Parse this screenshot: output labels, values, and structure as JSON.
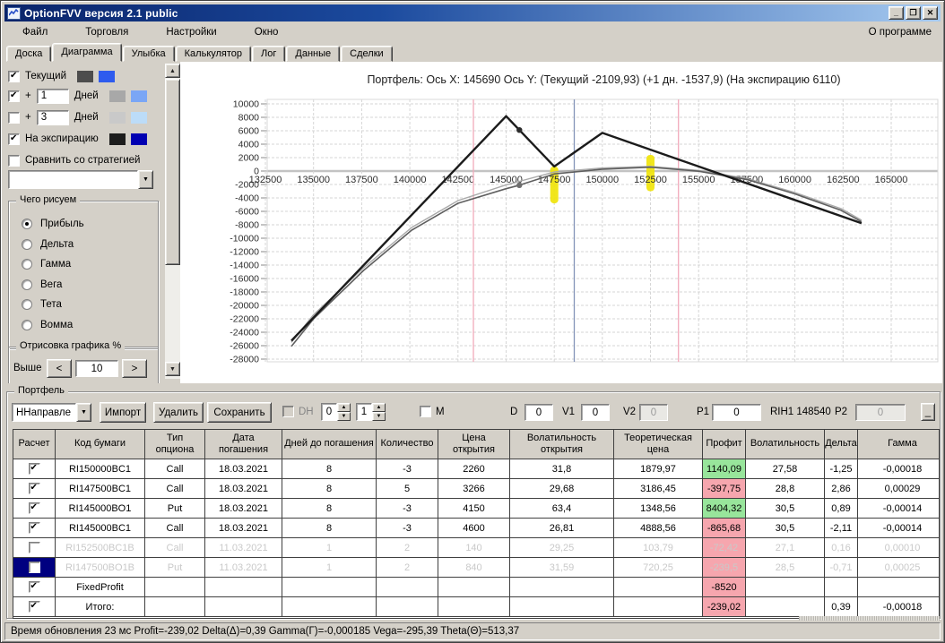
{
  "window": {
    "title": "OptionFVV версия 2.1 public",
    "buttons": {
      "minimize": "_",
      "maximize": "❐",
      "close": "✕"
    }
  },
  "menu": {
    "items": [
      "Файл",
      "Торговля",
      "Настройки",
      "Окно"
    ],
    "right_item": "О программе"
  },
  "tabs": {
    "items": [
      "Доска",
      "Диаграмма",
      "Улыбка",
      "Калькулятор",
      "Лог",
      "Данные",
      "Сделки"
    ],
    "active": "Диаграмма"
  },
  "left_panel": {
    "layers": [
      {
        "label": "Текущий",
        "checked": true,
        "swatches": [
          "#4d4d4d",
          "#2e5bee"
        ]
      },
      {
        "prefix": "+",
        "days_value": "1",
        "label": "Дней",
        "checked": true,
        "swatches": [
          "#a8a8a8",
          "#7aa6f5"
        ]
      },
      {
        "prefix": "+",
        "days_value": "3",
        "label": "Дней",
        "checked": false,
        "swatches": [
          "#c9c9c9",
          "#bcdcf8"
        ]
      },
      {
        "label": "На экспирацию",
        "checked": true,
        "swatches": [
          "#1d1d1d",
          "#0000b2"
        ]
      },
      {
        "label": "Сравнить со стратегией",
        "checked": false,
        "swatches": []
      }
    ],
    "strategy_dropdown_value": "",
    "draw_group": {
      "title": "Чего рисуем",
      "options": [
        "Прибыль",
        "Дельта",
        "Гамма",
        "Вега",
        "Тета",
        "Вомма"
      ],
      "selected": "Прибыль"
    },
    "render_group": {
      "title": "Отрисовка графика %",
      "label": "Выше",
      "dec_label": "<",
      "value": "10",
      "inc_label": ">"
    }
  },
  "chart_data": {
    "type": "line",
    "title": "Портфель: Ось X: 145690 Ось Y:  (Текущий -2109,93)  (+1 дн. -1537,9)  (На экспирацию 6110)",
    "x_range": [
      132500,
      165000
    ],
    "y_range": [
      -28000,
      10000
    ],
    "grid": true,
    "x_ticks": [
      132500,
      135000,
      137500,
      140000,
      142500,
      145000,
      147500,
      150000,
      152500,
      155000,
      157500,
      160000,
      162500,
      165000
    ],
    "y_ticks": [
      10000,
      8000,
      6000,
      4000,
      2000,
      0,
      -2000,
      -4000,
      -6000,
      -8000,
      -10000,
      -12000,
      -14000,
      -16000,
      -18000,
      -20000,
      -22000,
      -24000,
      -26000,
      -28000
    ],
    "series": [
      {
        "name": "+1 день",
        "color": "#a9a9a9",
        "width": 1.4,
        "points": [
          [
            133850,
            -25500
          ],
          [
            135000,
            -21400
          ],
          [
            137600,
            -14400
          ],
          [
            140100,
            -8400
          ],
          [
            142500,
            -4400
          ],
          [
            145000,
            -2050
          ],
          [
            145690,
            -1537.9
          ],
          [
            147500,
            -150
          ],
          [
            150000,
            450
          ],
          [
            152500,
            700
          ],
          [
            155000,
            100
          ],
          [
            157500,
            -1100
          ],
          [
            160000,
            -3200
          ],
          [
            162400,
            -5600
          ],
          [
            163460,
            -7300
          ]
        ]
      },
      {
        "name": "Текущий",
        "color": "#5f5f5f",
        "width": 1.6,
        "points": [
          [
            133850,
            -26100
          ],
          [
            135000,
            -22000
          ],
          [
            137600,
            -14800
          ],
          [
            140100,
            -8800
          ],
          [
            142500,
            -4800
          ],
          [
            145000,
            -2620
          ],
          [
            145690,
            -2109.93
          ],
          [
            147500,
            -420
          ],
          [
            150000,
            280
          ],
          [
            152500,
            580
          ],
          [
            155000,
            -30
          ],
          [
            157500,
            -1250
          ],
          [
            160000,
            -3400
          ],
          [
            162400,
            -5850
          ],
          [
            163460,
            -7550
          ]
        ]
      },
      {
        "name": "На экспирацию",
        "color": "#1b1b1b",
        "width": 2.4,
        "points": [
          [
            133850,
            -25270
          ],
          [
            145000,
            8180
          ],
          [
            147500,
            680
          ],
          [
            150000,
            5680
          ],
          [
            163460,
            -7780
          ]
        ]
      }
    ],
    "point_markers": [
      {
        "x": 145690,
        "y": 6110,
        "color": "#2b2b2b",
        "label": "На экспирацию 6110"
      },
      {
        "x": 145690,
        "y": -2109.93,
        "color": "#6e6e6e",
        "label": "Текущий -2109,93"
      }
    ],
    "ref_lines": [
      {
        "x": 143300,
        "color": "#f2aabb"
      },
      {
        "x": 148540,
        "color": "#8494b8"
      },
      {
        "x": 153950,
        "color": "#f2aabb"
      }
    ],
    "strike_marks": [
      {
        "x": 147500,
        "y_top": 700,
        "y_bottom": -4800,
        "color": "#f0e40a"
      },
      {
        "x": 152500,
        "y_top": 2400,
        "y_bottom": -3000,
        "color": "#f0e40a"
      }
    ]
  },
  "portfolio": {
    "group_title": "Портфель",
    "direction_combo": "ННаправле",
    "import_button": "Импорт",
    "delete_button": "Удалить",
    "save_button": "Сохранить",
    "dh_checkbox": {
      "label": "DH",
      "checked": false
    },
    "spin1": "0",
    "spin2": "1",
    "m_checkbox": {
      "label": "M",
      "checked": false
    },
    "fields": {
      "d_label": "D",
      "d": "0",
      "v1_label": "V1",
      "v1": "0",
      "v2_label": "V2",
      "v2": "0",
      "p1_label": "P1",
      "p1": "0",
      "instrument": "RIH1 148540",
      "p2_label": "P2",
      "p2": "0"
    },
    "collapse_button": "_"
  },
  "table": {
    "columns": [
      "Расчет",
      "Код бумаги",
      "Тип опциона",
      "Дата погашения",
      "Дней до погашения",
      "Количество",
      "Цена открытия",
      "Волатильность открытия",
      "Теоретическая цена",
      "Профит",
      "Волатильность",
      "Дельта",
      "Гамма"
    ],
    "profit_colors": {
      "positive": "#98e59b",
      "negative": "#f6a6ae"
    },
    "rows": [
      {
        "checked": true,
        "disabled": false,
        "selected": false,
        "cells": [
          "RI150000BC1",
          "Call",
          "18.03.2021",
          "8",
          "-3",
          "2260",
          "31,8",
          "1879,97",
          "1140,09",
          "27,58",
          "-1,25",
          "-0,00018"
        ]
      },
      {
        "checked": true,
        "disabled": false,
        "selected": false,
        "cells": [
          "RI147500BC1",
          "Call",
          "18.03.2021",
          "8",
          "5",
          "3266",
          "29,68",
          "3186,45",
          "-397,75",
          "28,8",
          "2,86",
          "0,00029"
        ]
      },
      {
        "checked": true,
        "disabled": false,
        "selected": false,
        "cells": [
          "RI145000BO1",
          "Put",
          "18.03.2021",
          "8",
          "-3",
          "4150",
          "63,4",
          "1348,56",
          "8404,32",
          "30,5",
          "0,89",
          "-0,00014"
        ]
      },
      {
        "checked": true,
        "disabled": false,
        "selected": false,
        "cells": [
          "RI145000BC1",
          "Call",
          "18.03.2021",
          "8",
          "-3",
          "4600",
          "26,81",
          "4888,56",
          "-865,68",
          "30,5",
          "-2,11",
          "-0,00014"
        ]
      },
      {
        "checked": false,
        "disabled": true,
        "selected": false,
        "cells": [
          "RI152500BC1B",
          "Call",
          "11.03.2021",
          "1",
          "2",
          "140",
          "29,25",
          "103,79",
          "-72,42",
          "27,1",
          "0,16",
          "0,00010"
        ]
      },
      {
        "checked": false,
        "disabled": true,
        "selected": true,
        "cells": [
          "RI147500BO1B",
          "Put",
          "11.03.2021",
          "1",
          "2",
          "840",
          "31,59",
          "720,25",
          "-239,5",
          "28,5",
          "-0,71",
          "0,00025"
        ]
      },
      {
        "checked": true,
        "disabled": false,
        "selected": false,
        "cells": [
          "FixedProfit",
          "",
          "",
          "",
          "",
          "",
          "",
          "",
          "-8520",
          "",
          "",
          ""
        ]
      },
      {
        "checked": true,
        "disabled": false,
        "selected": false,
        "cells": [
          "Итого:",
          "",
          "",
          "",
          "",
          "",
          "",
          "",
          "-239,02",
          "",
          "0,39",
          "-0,00018"
        ]
      }
    ]
  },
  "status_bar": "Время обновления 23 мс  Profit=-239,02 Delta(Δ)=0,39 Gamma(Γ)=-0,000185 Vega=-295,39 Theta(Θ)=513,37"
}
